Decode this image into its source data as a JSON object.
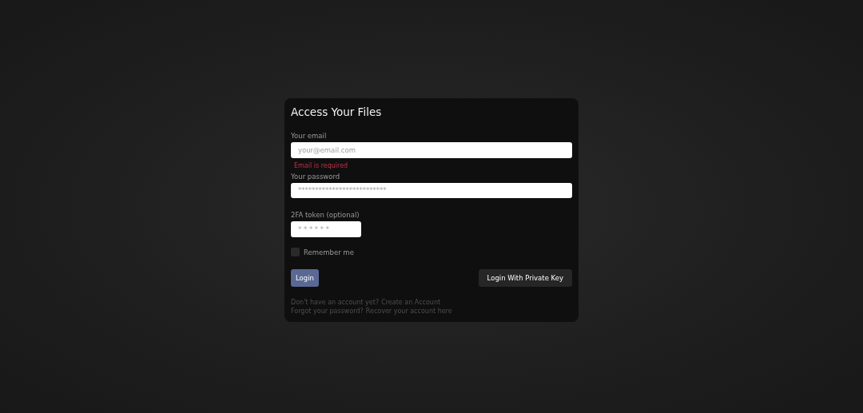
{
  "card": {
    "title": "Access Your Files",
    "fields": [
      {
        "label": "Your email",
        "placeholder": "your@email.com",
        "error": "Email is required",
        "wide": true
      },
      {
        "label": "Your password",
        "placeholder": "**************************",
        "wide": true
      },
      {
        "label": "2FA token (optional)",
        "placeholder": "* * * * * *",
        "wide": false
      }
    ],
    "remember": {
      "label": "Remember me",
      "checked": false
    },
    "buttons": [
      {
        "label": "Login",
        "kind": "primary"
      },
      {
        "label": "Login With Private Key",
        "kind": "secondary"
      }
    ],
    "footer": [
      {
        "text": "Don't have an account yet?",
        "link": "Create an Account"
      },
      {
        "text": "Forgot your password?",
        "link": "Recover your account here"
      }
    ]
  }
}
